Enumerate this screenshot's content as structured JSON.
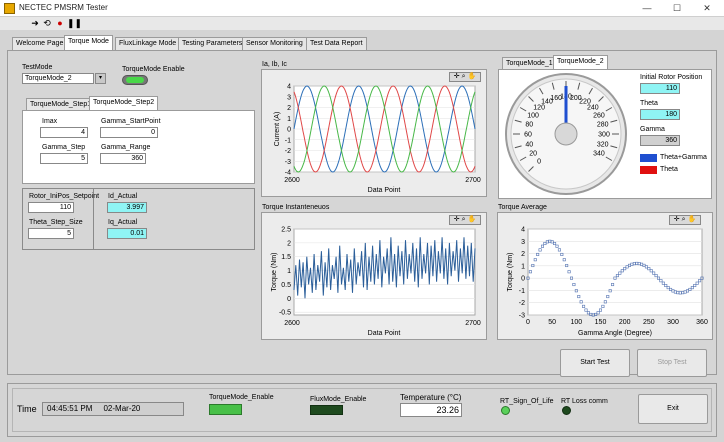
{
  "window": {
    "title": "NECTEC PMSRM Tester",
    "icons": [
      "run-arrow-icon",
      "run-continuous-icon",
      "abort-icon",
      "pause-icon"
    ],
    "controls": [
      "—",
      "☐",
      "✕"
    ]
  },
  "tabs": [
    {
      "label": "Welcome Page"
    },
    {
      "label": "Torque Mode"
    },
    {
      "label": "FluxLinkage Mode"
    },
    {
      "label": "Testing Parameters"
    },
    {
      "label": "Sensor Monitoring"
    },
    {
      "label": "Test Data Report"
    }
  ],
  "torque_mode": {
    "test_mode_label": "TestMode",
    "test_mode_value": "TorqueMode_2",
    "enable_label": "TorqueMode Enable",
    "step_tabs": [
      "TorqueMode_Step1",
      "TorqueMode_Step2"
    ],
    "imax_label": "Imax",
    "imax_value": "4",
    "gamma_start_label": "Gamma_StartPoint",
    "gamma_start_value": "0",
    "gamma_step_label": "Gamma_Step",
    "gamma_step_value": "5",
    "gamma_range_label": "Gamma_Range",
    "gamma_range_value": "360",
    "rotor_ini_label": "Rotor_IniPos_Setpoint",
    "rotor_ini_value": "110",
    "theta_step_label": "Theta_Step_Size",
    "theta_step_value": "5",
    "id_actual_label": "Id_Actual",
    "id_actual_value": "3.997",
    "iq_actual_label": "Iq_Actual",
    "iq_actual_value": "0.01"
  },
  "graphs": {
    "currents_title": "Ia, Ib, Ic",
    "torque_inst_title": "Torque Instanteneuos",
    "torque_avg_title": "Torque Average",
    "palette_glyphs": "✛ ⌕ ✋"
  },
  "gauge_panel": {
    "tabs": [
      "TorqueMode_1",
      "TorqueMode_2"
    ],
    "initial_rotor_label": "Initial Rotor Position",
    "initial_rotor_value": "110",
    "theta_label": "Theta",
    "theta_value": "180",
    "gamma_label": "Gamma",
    "gamma_value": "360",
    "legend": [
      {
        "name": "Theta+Gamma",
        "color": "#1f4fd0"
      },
      {
        "name": "Theta",
        "color": "#e01010"
      }
    ],
    "ticks": [
      "0",
      "20",
      "40",
      "60",
      "80",
      "100",
      "120",
      "140",
      "160",
      "180",
      "200",
      "220",
      "240",
      "260",
      "280",
      "300",
      "320",
      "340"
    ],
    "needle_value": 180
  },
  "buttons": {
    "start_test": "Start Test",
    "stop_test": "Stop Test",
    "exit": "Exit"
  },
  "status_bar": {
    "time_label": "Time",
    "time_value": "04:45:51 PM     02-Mar-20",
    "torque_enable_label": "TorqueMode_Enable",
    "flux_enable_label": "FluxMode_Enable",
    "temperature_label": "Temperature  (°C)",
    "temperature_value": "23.26",
    "rt_sign_label": "RT_Sign_Of_Life",
    "rt_loss_label": "RT Loss comm"
  },
  "chart_data": [
    {
      "type": "line",
      "title": "Ia, Ib, Ic",
      "xlabel": "Data Point",
      "ylabel": "Current (A)",
      "xlim": [
        2600,
        2700
      ],
      "ylim": [
        -4,
        4
      ],
      "x_ticks": [
        "2600",
        "2700"
      ],
      "y_ticks": [
        "4",
        "3",
        "2",
        "1",
        "0",
        "-1",
        "-2",
        "-3",
        "-4"
      ],
      "series": [
        {
          "amplitude": 4,
          "phase_deg": 0,
          "color": "#2c6fb8"
        },
        {
          "amplitude": 4,
          "phase_deg": 120,
          "color": "#e04848"
        },
        {
          "amplitude": 4,
          "phase_deg": 240,
          "color": "#48b848"
        }
      ],
      "cycles": 3.5
    },
    {
      "type": "line",
      "title": "Torque Instanteneuos",
      "xlabel": "Data Point",
      "ylabel": "Torque (Nm)",
      "xlim": [
        2600,
        2700
      ],
      "ylim": [
        -0.6,
        2.5
      ],
      "x_ticks": [
        "2600",
        "2700"
      ],
      "y_ticks": [
        "2.5",
        "2",
        "1.5",
        "1",
        "0.5",
        "0",
        "-0.5"
      ],
      "series": [
        {
          "color": "#2c5f9a",
          "values": [
            0.3,
            1.2,
            0.1,
            1.4,
            0.4,
            1.3,
            0.0,
            1.5,
            0.5,
            1.1,
            0.2,
            1.6,
            0.3,
            1.2,
            0.6,
            1.7,
            0.1,
            1.3,
            0.4,
            1.8,
            0.3,
            1.2,
            0.7,
            1.5,
            0.2,
            1.9,
            0.5,
            1.1,
            0.3,
            1.6,
            0.6,
            1.4,
            0.2,
            1.8,
            0.5,
            1.3,
            0.8,
            1.7,
            0.4,
            2.0,
            0.3,
            1.5,
            0.6,
            1.9,
            0.5,
            1.6,
            0.7,
            2.1,
            0.4,
            1.5,
            0.9,
            1.8,
            0.5,
            2.2,
            0.6,
            1.6,
            0.4,
            1.9,
            0.8,
            1.7,
            0.5,
            2.1,
            0.7,
            1.6,
            0.9,
            2.0,
            0.6,
            1.8,
            0.4,
            2.2,
            0.7,
            1.6,
            0.9,
            2.0,
            0.5,
            1.9,
            0.8,
            2.1,
            0.6,
            1.7,
            0.9,
            2.2,
            0.7,
            1.8,
            0.5,
            2.0,
            0.8,
            1.7,
            1.0,
            2.1,
            0.6,
            1.8,
            0.9,
            2.2,
            0.7,
            1.9,
            0.8,
            2.0,
            0.6,
            1.8
          ]
        }
      ]
    },
    {
      "type": "scatter",
      "title": "Torque Average",
      "xlabel": "Gamma Angle (Degree)",
      "ylabel": "Torque (Nm)",
      "xlim": [
        0,
        360
      ],
      "ylim": [
        -3,
        4
      ],
      "x_ticks": [
        "0",
        "50",
        "100",
        "150",
        "200",
        "250",
        "300",
        "360"
      ],
      "y_ticks": [
        "4",
        "3",
        "2",
        "1",
        "0",
        "-1",
        "-2",
        "-3"
      ],
      "series": [
        {
          "color": "#5070b0",
          "step": 5,
          "amp1": 3.0,
          "amp2": 1.2
        }
      ]
    }
  ]
}
